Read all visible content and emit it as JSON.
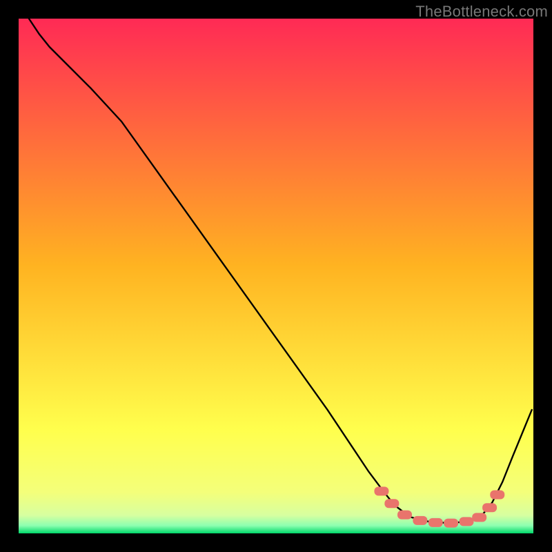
{
  "watermark": "TheBottleneck.com",
  "chart_data": {
    "type": "line",
    "title": "",
    "xlabel": "",
    "ylabel": "",
    "xlim": [
      0,
      100
    ],
    "ylim": [
      0,
      100
    ],
    "background_gradient": {
      "stops": [
        {
          "offset": 0.0,
          "color": "#ff2a55"
        },
        {
          "offset": 0.48,
          "color": "#ffb321"
        },
        {
          "offset": 0.8,
          "color": "#ffff4d"
        },
        {
          "offset": 0.92,
          "color": "#f4ff7a"
        },
        {
          "offset": 0.965,
          "color": "#d7ffa0"
        },
        {
          "offset": 0.985,
          "color": "#8cffb0"
        },
        {
          "offset": 1.0,
          "color": "#00d86a"
        }
      ]
    },
    "series": [
      {
        "name": "bottleneck-curve",
        "color": "#000000",
        "x": [
          2,
          4,
          6,
          10,
          14,
          20,
          30,
          40,
          50,
          60,
          68,
          71,
          73,
          76,
          80,
          84,
          88,
          90,
          92,
          94,
          96,
          99.7
        ],
        "y": [
          100,
          97,
          94.5,
          90.5,
          86.5,
          80,
          66,
          52,
          38,
          24,
          12,
          8,
          5.5,
          3.2,
          2.2,
          2.0,
          2.4,
          3.5,
          6.0,
          10,
          15,
          24
        ]
      }
    ],
    "markers": {
      "name": "optimal-range",
      "color": "#e9746c",
      "shape": "rounded-rect",
      "points": [
        {
          "x": 70.5,
          "y": 8.2
        },
        {
          "x": 72.5,
          "y": 5.8
        },
        {
          "x": 75.0,
          "y": 3.6
        },
        {
          "x": 78.0,
          "y": 2.5
        },
        {
          "x": 81.0,
          "y": 2.1
        },
        {
          "x": 84.0,
          "y": 2.0
        },
        {
          "x": 87.0,
          "y": 2.3
        },
        {
          "x": 89.5,
          "y": 3.1
        },
        {
          "x": 91.5,
          "y": 5.0
        },
        {
          "x": 93.0,
          "y": 7.5
        }
      ]
    }
  }
}
